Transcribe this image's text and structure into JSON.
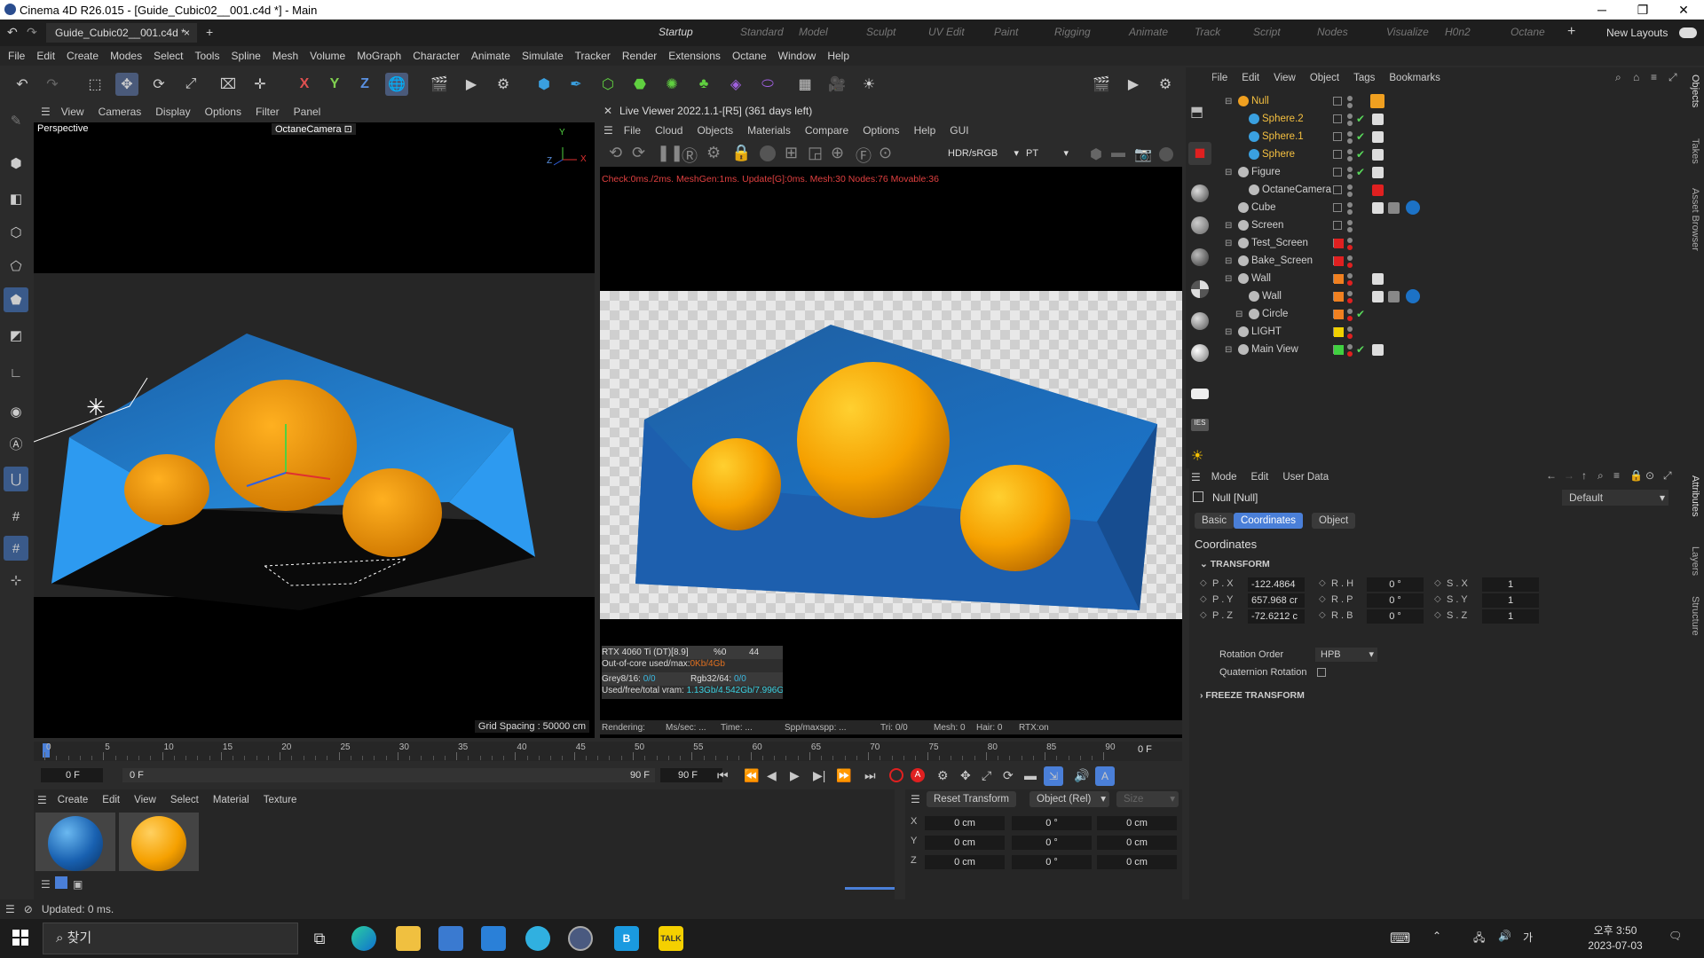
{
  "window": {
    "title": "Cinema 4D R26.015 - [Guide_Cubic02__001.c4d *] - Main",
    "min": "─",
    "max": "❐",
    "close": "✕"
  },
  "tabs": {
    "doc_tab": "Guide_Cubic02__001.c4d *",
    "close": "×",
    "add": "+",
    "layouts": [
      "Startup",
      "Standard",
      "Model",
      "Sculpt",
      "UV Edit",
      "Paint",
      "Rigging",
      "Animate",
      "Track",
      "Script",
      "Nodes",
      "Visualize",
      "H0n2",
      "Octane"
    ],
    "new_layouts": "New Layouts"
  },
  "menubar": [
    "File",
    "Edit",
    "Create",
    "Modes",
    "Select",
    "Tools",
    "Spline",
    "Mesh",
    "Volume",
    "MoGraph",
    "Character",
    "Animate",
    "Simulate",
    "Tracker",
    "Render",
    "Extensions",
    "Octane",
    "Window",
    "Help"
  ],
  "toolbar": {
    "axes": [
      "X",
      "Y",
      "Z"
    ]
  },
  "viewport": {
    "menu": [
      "View",
      "Cameras",
      "Display",
      "Options",
      "Filter",
      "Panel"
    ],
    "label": "Perspective",
    "camera": "OctaneCamera",
    "grid": "Grid Spacing : 50000 cm",
    "axis_y": "Y",
    "axis_x": "X",
    "axis_z": "Z"
  },
  "liveviewer": {
    "title": "Live Viewer 2022.1.1-[R5] (361 days left)",
    "menu": [
      "File",
      "Cloud",
      "Objects",
      "Materials",
      "Compare",
      "Options",
      "Help",
      "GUI"
    ],
    "colorspace": "HDR/sRGB",
    "kernel": "PT",
    "status": "Check:0ms./2ms. MeshGen:1ms. Update[G]:0ms. Mesh:30 Nodes:76 Movable:36",
    "gpu": "RTX 4060 Ti (DT)[8.9]",
    "gpu_pct": "%0",
    "gpu_num": "44",
    "ooc_label": "Out-of-core used/max:",
    "ooc_val": "0Kb/4Gb",
    "grey_label": "Grey8/16: ",
    "grey_val": "0/0",
    "rgb_label": "Rgb32/64: ",
    "rgb_val": "0/0",
    "vram_label": "Used/free/total vram: ",
    "vram_val": "1.13Gb/4.542Gb/7.996G",
    "render_bar": [
      "Rendering:",
      "Ms/sec: ...",
      "Time: ...",
      "Spp/maxspp: ...",
      "Tri: 0/0",
      "Mesh: 0",
      "Hair: 0",
      "RTX:on"
    ]
  },
  "objects": {
    "menu": [
      "File",
      "Edit",
      "View",
      "Object",
      "Tags",
      "Bookmarks"
    ],
    "items": [
      {
        "name": "Null"
      },
      {
        "name": "Sphere.2"
      },
      {
        "name": "Sphere.1"
      },
      {
        "name": "Sphere"
      },
      {
        "name": "Figure"
      },
      {
        "name": "OctaneCamera"
      },
      {
        "name": "Cube"
      },
      {
        "name": "Screen"
      },
      {
        "name": "Test_Screen"
      },
      {
        "name": "Bake_Screen"
      },
      {
        "name": "Wall"
      },
      {
        "name": "Wall"
      },
      {
        "name": "Circle"
      },
      {
        "name": "LIGHT"
      },
      {
        "name": "Main View"
      }
    ]
  },
  "attributes": {
    "menu": [
      "Mode",
      "Edit",
      "User Data"
    ],
    "object": "Null [Null]",
    "preset": "Default",
    "tabs": [
      "Basic",
      "Coordinates",
      "Object"
    ],
    "section": "Coordinates",
    "transform": "TRANSFORM",
    "rows": [
      {
        "p": "P . X",
        "pv": "-122.4864",
        "r": "R . H",
        "rv": "0 °",
        "s": "S . X",
        "sv": "1"
      },
      {
        "p": "P . Y",
        "pv": "657.968 cr",
        "r": "R . P",
        "rv": "0 °",
        "s": "S . Y",
        "sv": "1"
      },
      {
        "p": "P . Z",
        "pv": "-72.6212 c",
        "r": "R . B",
        "rv": "0 °",
        "s": "S . Z",
        "sv": "1"
      }
    ],
    "rot_order_label": "Rotation Order",
    "rot_order": "HPB",
    "quat": "Quaternion Rotation",
    "freeze": "FREEZE TRANSFORM"
  },
  "right_tabs": [
    "Objects",
    "Takes",
    "Asset Browser",
    "Attributes",
    "Layers",
    "Structure"
  ],
  "timeline": {
    "ticks": [
      "0",
      "5",
      "10",
      "15",
      "20",
      "25",
      "30",
      "35",
      "40",
      "45",
      "50",
      "55",
      "60",
      "65",
      "70",
      "75",
      "80",
      "85",
      "90"
    ],
    "frame": "0 F",
    "start": "0 F",
    "start2": "0 F",
    "end": "90 F",
    "end2": "90 F"
  },
  "materials": {
    "menu": [
      "Create",
      "Edit",
      "View",
      "Select",
      "Material",
      "Texture"
    ]
  },
  "coords": {
    "reset": "Reset Transform",
    "mode": "Object (Rel)",
    "size": "Size",
    "axes": [
      "X",
      "Y",
      "Z"
    ],
    "pos": [
      "0 cm",
      "0 cm",
      "0 cm"
    ],
    "rot": [
      "0 °",
      "0 °",
      "0 °"
    ],
    "sz": [
      "0 cm",
      "0 cm",
      "0 cm"
    ]
  },
  "status": "Updated: 0 ms.",
  "taskbar": {
    "search": "찾기",
    "time": "오후 3:50",
    "date": "2023-07-03",
    "ime": "가"
  },
  "colors": {
    "accent": "#4a7fd8",
    "orange": "#f0a020",
    "blue": "#1c72c6",
    "green": "#58d65a",
    "red": "#e02020"
  }
}
